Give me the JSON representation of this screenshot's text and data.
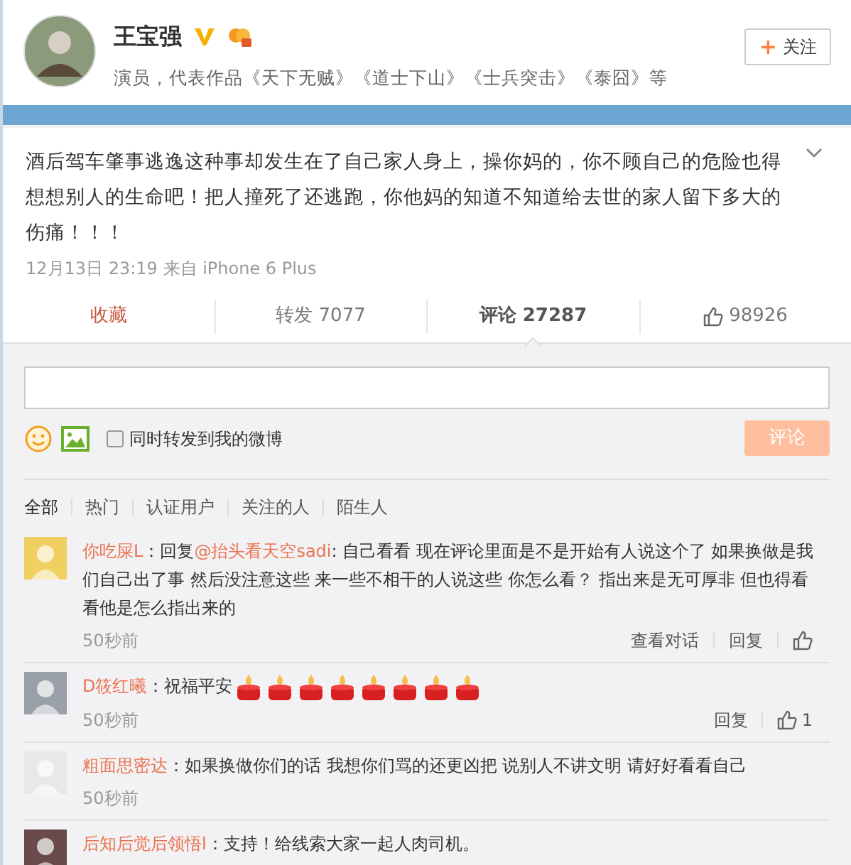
{
  "profile": {
    "name": "王宝强",
    "verified": true,
    "bio": "演员，代表作品《天下无贼》《道士下山》《士兵突击》《泰囧》等",
    "follow_button": {
      "icon": "+",
      "label": "关注"
    }
  },
  "post": {
    "text": "酒后驾车肇事逃逸这种事却发生在了自己家人身上，操你妈的，你不顾自己的危险也得想想别人的生命吧！把人撞死了还逃跑，你他妈的知道不知道给去世的家人留下多大的伤痛！！！",
    "time": "12月13日 23:19 来自 iPhone 6 Plus"
  },
  "actions": [
    {
      "kind": "favorite",
      "label": "收藏",
      "selected": false
    },
    {
      "kind": "repost",
      "label": "转发 7077",
      "selected": false
    },
    {
      "kind": "comment",
      "label": "评论 27287",
      "selected": true
    },
    {
      "kind": "like",
      "label": "98926",
      "selected": false
    }
  ],
  "composer": {
    "repost_label": "同时转发到我的微博",
    "repost_checked": false,
    "submit": "评论",
    "submit_disabled": true
  },
  "filters": [
    {
      "label": "全部",
      "selected": true
    },
    {
      "label": "热门",
      "selected": false
    },
    {
      "label": "认证用户",
      "selected": false
    },
    {
      "label": "关注的人",
      "selected": false
    },
    {
      "label": "陌生人",
      "selected": false
    }
  ],
  "comments": [
    {
      "name": "你吃屎L",
      "prefix": "：回复",
      "mention": "@抬头看天空sadi",
      "text": ": 自己看看 现在评论里面是不是开始有人说这个了 如果换做是我们自己出了事 然后没注意这些 来一些不相干的人说这些 你怎么看？ 指出来是无可厚非 但也得看看他是怎么指出来的",
      "time": "50秒前",
      "links": [
        "查看对话",
        "回复"
      ],
      "like": true
    },
    {
      "name": "D筱红曦",
      "text": "：祝福平安",
      "emoticons": [
        {
          "kind": "candle"
        },
        {
          "kind": "candle"
        },
        {
          "kind": "candle"
        },
        {
          "kind": "candle"
        },
        {
          "kind": "candle"
        },
        {
          "kind": "candle"
        },
        {
          "kind": "candle"
        },
        {
          "kind": "candle"
        }
      ],
      "time": "50秒前",
      "links": [
        "回复"
      ],
      "like": true,
      "like_count": "1"
    },
    {
      "name": "粗面思密达",
      "text": "：如果换做你们的话 我想你们骂的还更凶把 说别人不讲文明 请好好看看自己",
      "time": "50秒前"
    },
    {
      "name": "后知后觉后领悟l",
      "text": "：支持！给线索大家一起人肉司机。"
    }
  ]
}
